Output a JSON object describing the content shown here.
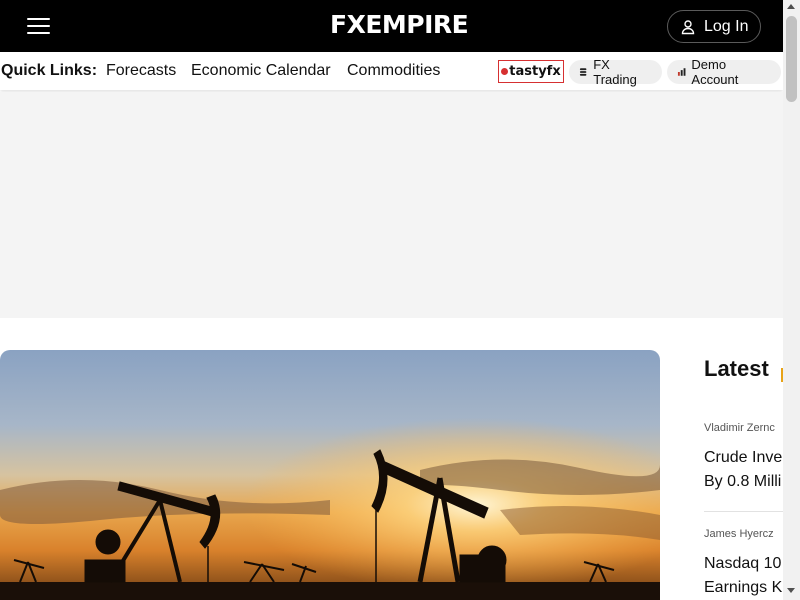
{
  "header": {
    "logo_text": "FXEMPIRE",
    "login_label": "Log In",
    "menu_icon": "hamburger-menu-icon",
    "user_icon": "user-icon"
  },
  "quick_links": {
    "label": "Quick Links:",
    "links": [
      "Forecasts",
      "Economic Calendar",
      "Commodities"
    ],
    "sponsor": {
      "text": "tastyfx",
      "icon": "tastyfx-logo-icon"
    },
    "pills": [
      {
        "label": "FX Trading",
        "icon": "coins-icon"
      },
      {
        "label": "Demo Account",
        "icon": "bar-chart-icon"
      }
    ]
  },
  "latest": {
    "title": "Latest",
    "items": [
      {
        "author": "Vladimir Zernc",
        "headline_line1": "Crude Inve",
        "headline_line2": "By 0.8 Milli"
      },
      {
        "author": "James Hyercz",
        "headline_line1": "Nasdaq 10",
        "headline_line2": "Earnings K"
      }
    ]
  },
  "colors": {
    "header_bg": "#000000",
    "accent": "#e8a317",
    "sponsor_red": "#d63031",
    "ad_bg": "#f4f4f4"
  }
}
